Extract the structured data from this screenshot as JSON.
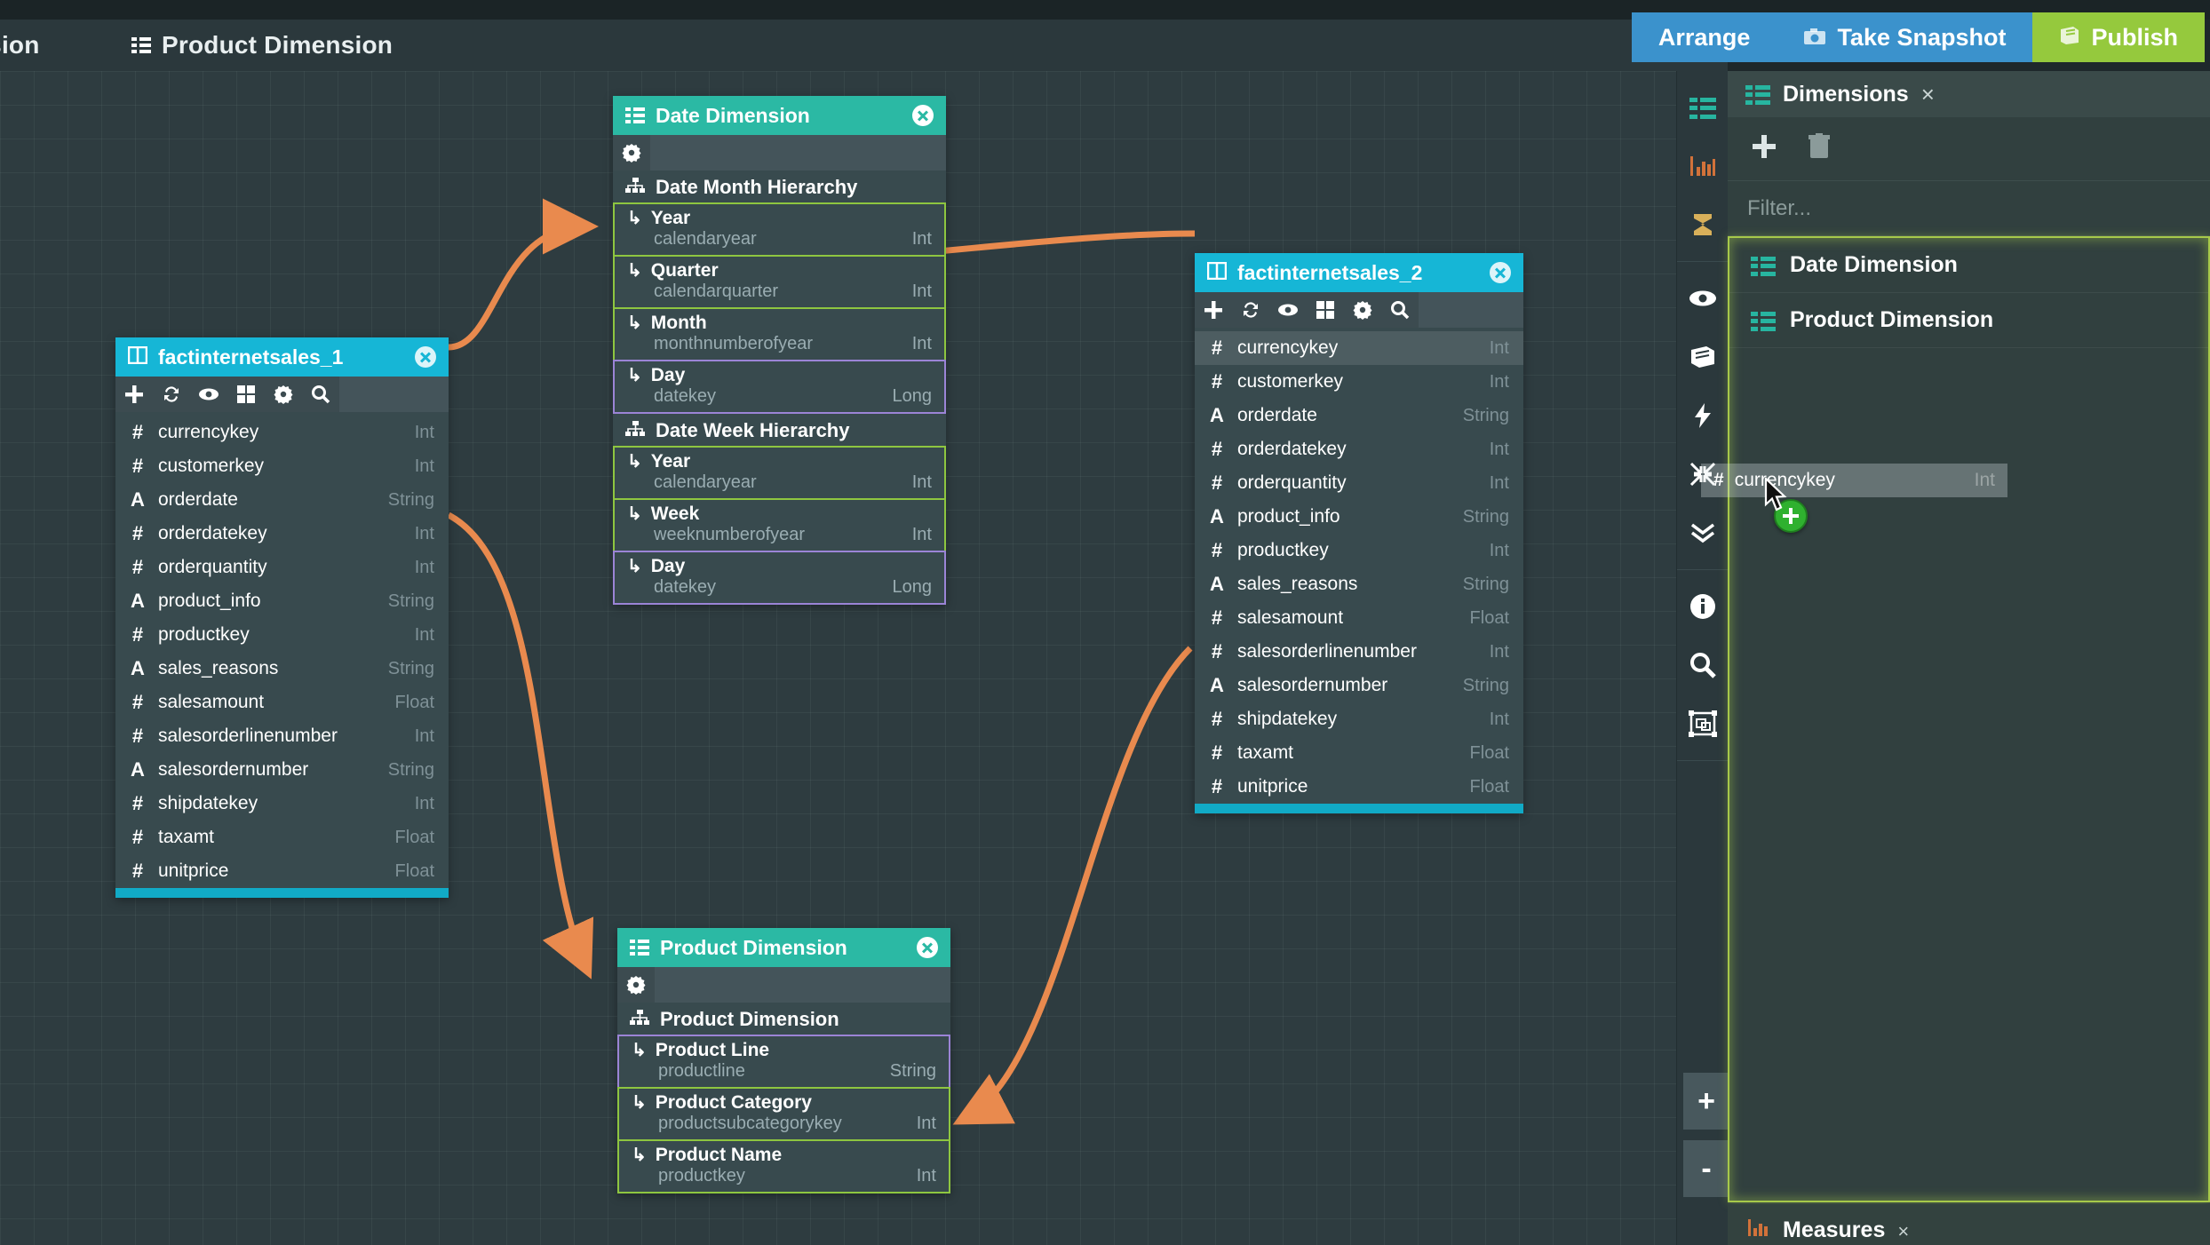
{
  "tabs": [
    {
      "label": "mension",
      "icon": "list-icon",
      "partial": true
    },
    {
      "label": "Product Dimension",
      "icon": "list-icon",
      "partial": false
    }
  ],
  "top_buttons": [
    {
      "label": "Arrange",
      "icon": null,
      "style": "blue"
    },
    {
      "label": "Take Snapshot",
      "icon": "camera-icon",
      "style": "blue"
    },
    {
      "label": "Publish",
      "icon": "book-icon",
      "style": "green"
    }
  ],
  "colors": {
    "fact_header": "#16b6d6",
    "dimension_header": "#2bb9a4",
    "connector": "#e98a4e",
    "hierarchy_level_green": "#8ec640",
    "hierarchy_level_purple": "#9b84d6",
    "publish_green": "#95c93d",
    "toolbar_blue": "#3b92cc",
    "canvas": "#2e3c40",
    "selection_glow": "#a7c94a"
  },
  "nodes": {
    "factinternetsales_1": {
      "title": "factinternetsales_1",
      "type": "fact-table",
      "toolbar": [
        "add-icon",
        "refresh-icon",
        "eye-icon",
        "grid-icon",
        "gear-icon",
        "search-icon"
      ],
      "fields": [
        {
          "name": "currencykey",
          "datatype": "Int",
          "kind": "numeric"
        },
        {
          "name": "customerkey",
          "datatype": "Int",
          "kind": "numeric"
        },
        {
          "name": "orderdate",
          "datatype": "String",
          "kind": "text"
        },
        {
          "name": "orderdatekey",
          "datatype": "Int",
          "kind": "numeric"
        },
        {
          "name": "orderquantity",
          "datatype": "Int",
          "kind": "numeric"
        },
        {
          "name": "product_info",
          "datatype": "String",
          "kind": "text"
        },
        {
          "name": "productkey",
          "datatype": "Int",
          "kind": "numeric"
        },
        {
          "name": "sales_reasons",
          "datatype": "String",
          "kind": "text"
        },
        {
          "name": "salesamount",
          "datatype": "Float",
          "kind": "numeric"
        },
        {
          "name": "salesorderlinenumber",
          "datatype": "Int",
          "kind": "numeric"
        },
        {
          "name": "salesordernumber",
          "datatype": "String",
          "kind": "text"
        },
        {
          "name": "shipdatekey",
          "datatype": "Int",
          "kind": "numeric"
        },
        {
          "name": "taxamt",
          "datatype": "Float",
          "kind": "numeric"
        },
        {
          "name": "unitprice",
          "datatype": "Float",
          "kind": "numeric"
        }
      ]
    },
    "factinternetsales_2": {
      "title": "factinternetsales_2",
      "type": "fact-table",
      "toolbar": [
        "add-icon",
        "refresh-icon",
        "eye-icon",
        "grid-icon",
        "gear-icon",
        "search-icon"
      ],
      "fields": [
        {
          "name": "currencykey",
          "datatype": "Int",
          "kind": "numeric",
          "highlighted": true
        },
        {
          "name": "customerkey",
          "datatype": "Int",
          "kind": "numeric"
        },
        {
          "name": "orderdate",
          "datatype": "String",
          "kind": "text"
        },
        {
          "name": "orderdatekey",
          "datatype": "Int",
          "kind": "numeric"
        },
        {
          "name": "orderquantity",
          "datatype": "Int",
          "kind": "numeric"
        },
        {
          "name": "product_info",
          "datatype": "String",
          "kind": "text"
        },
        {
          "name": "productkey",
          "datatype": "Int",
          "kind": "numeric"
        },
        {
          "name": "sales_reasons",
          "datatype": "String",
          "kind": "text"
        },
        {
          "name": "salesamount",
          "datatype": "Float",
          "kind": "numeric"
        },
        {
          "name": "salesorderlinenumber",
          "datatype": "Int",
          "kind": "numeric"
        },
        {
          "name": "salesordernumber",
          "datatype": "String",
          "kind": "text"
        },
        {
          "name": "shipdatekey",
          "datatype": "Int",
          "kind": "numeric"
        },
        {
          "name": "taxamt",
          "datatype": "Float",
          "kind": "numeric"
        },
        {
          "name": "unitprice",
          "datatype": "Float",
          "kind": "numeric"
        }
      ]
    },
    "date_dimension": {
      "title": "Date Dimension",
      "type": "dimension",
      "toolbar": [
        "gear-icon"
      ],
      "hierarchies": [
        {
          "name": "Date Month Hierarchy",
          "levels": [
            {
              "label": "Year",
              "column": "calendaryear",
              "datatype": "Int",
              "color": "green"
            },
            {
              "label": "Quarter",
              "column": "calendarquarter",
              "datatype": "Int",
              "color": "green"
            },
            {
              "label": "Month",
              "column": "monthnumberofyear",
              "datatype": "Int",
              "color": "green"
            },
            {
              "label": "Day",
              "column": "datekey",
              "datatype": "Long",
              "color": "purple"
            }
          ]
        },
        {
          "name": "Date Week Hierarchy",
          "levels": [
            {
              "label": "Year",
              "column": "calendaryear",
              "datatype": "Int",
              "color": "green"
            },
            {
              "label": "Week",
              "column": "weeknumberofyear",
              "datatype": "Int",
              "color": "green"
            },
            {
              "label": "Day",
              "column": "datekey",
              "datatype": "Long",
              "color": "purple"
            }
          ]
        }
      ]
    },
    "product_dimension": {
      "title": "Product Dimension",
      "type": "dimension",
      "toolbar": [
        "gear-icon"
      ],
      "hierarchies": [
        {
          "name": "Product Dimension",
          "levels": [
            {
              "label": "Product Line",
              "column": "productline",
              "datatype": "String",
              "color": "purple"
            },
            {
              "label": "Product Category",
              "column": "productsubcategorykey",
              "datatype": "Int",
              "color": "green"
            },
            {
              "label": "Product Name",
              "column": "productkey",
              "datatype": "Int",
              "color": "green"
            }
          ]
        }
      ]
    }
  },
  "vertical_toolbar": [
    {
      "icon": "dimensions-list-icon",
      "group": 1
    },
    {
      "icon": "measures-chart-icon",
      "group": 1
    },
    {
      "icon": "sigma-icon",
      "group": 1
    },
    {
      "icon": "eye-icon",
      "group": 2
    },
    {
      "icon": "book-icon",
      "group": 2
    },
    {
      "icon": "lightning-icon",
      "group": 2
    },
    {
      "icon": "collapse-arrows-icon",
      "group": 2
    },
    {
      "icon": "double-chevron-down-icon",
      "group": 2
    },
    {
      "icon": "info-icon",
      "group": 3
    },
    {
      "icon": "search-icon",
      "group": 3
    },
    {
      "icon": "select-frame-icon",
      "group": 3
    }
  ],
  "right_panel": {
    "title": "Dimensions",
    "close_label": "×",
    "actions": [
      {
        "icon": "add-icon",
        "name": "add-dimension"
      },
      {
        "icon": "trash-icon",
        "name": "delete-dimension"
      }
    ],
    "filter_placeholder": "Filter...",
    "items": [
      {
        "label": "Date Dimension",
        "icon": "list-icon"
      },
      {
        "label": "Product Dimension",
        "icon": "list-icon"
      }
    ],
    "measures_label": "Measures",
    "measures_close": "×"
  },
  "zoom_controls": {
    "zoom_in": "+",
    "zoom_out": "-"
  },
  "drag_ghost": {
    "type_glyph": "#",
    "name": "currencykey",
    "datatype": "Int"
  }
}
